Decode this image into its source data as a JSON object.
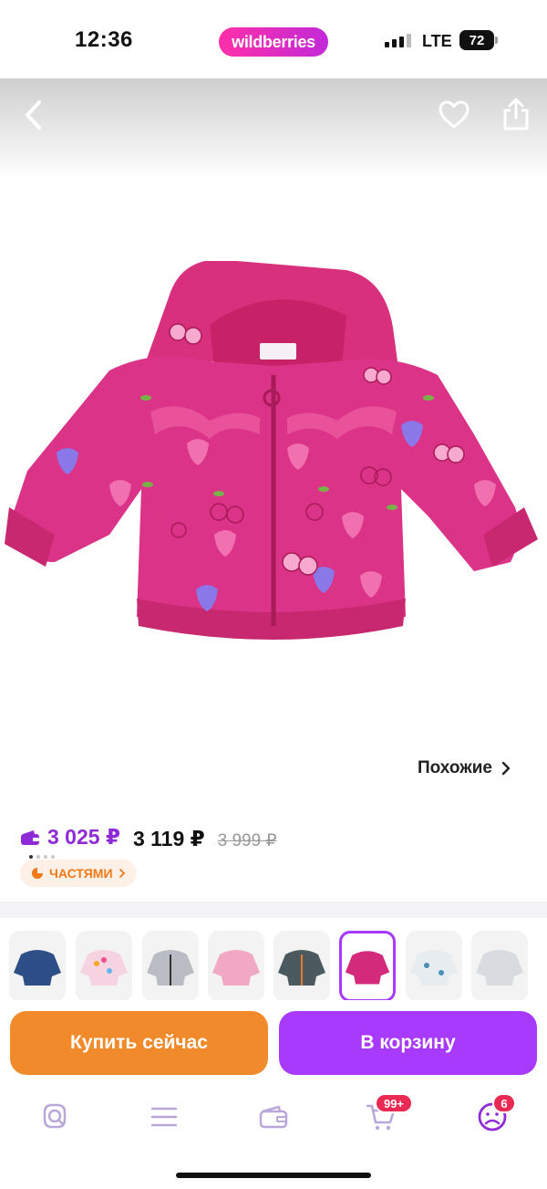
{
  "status_bar": {
    "time": "12:36",
    "brand": "wildberries",
    "network": "LTE",
    "battery": "72"
  },
  "header": {
    "back_icon": "chevron-left-icon",
    "favorite_icon": "heart-icon",
    "share_icon": "share-icon"
  },
  "gallery": {
    "product_image": "pink-strawberry-cherry-print-hooded-jacket",
    "dots_count": 4,
    "active_dot": 0,
    "similar_label": "Похожие"
  },
  "pricing": {
    "wallet_price": "3 025 ₽",
    "price": "3 119 ₽",
    "old_price": "3 999 ₽",
    "installments_label": "ЧАСТЯМИ",
    "wallet_color": "#8f2bd6"
  },
  "variants": [
    {
      "name": "navy-print-jacket",
      "color": "#2d4e86",
      "selected": false
    },
    {
      "name": "white-multicolor-dots-jacket",
      "color": "#f5d3e0",
      "selected": false
    },
    {
      "name": "grey-print-jacket",
      "color": "#b9bcc2",
      "selected": false
    },
    {
      "name": "light-pink-jacket",
      "color": "#f1a8c3",
      "selected": false
    },
    {
      "name": "dark-teal-print-jacket",
      "color": "#4a5a5e",
      "selected": false
    },
    {
      "name": "pink-strawberry-jacket",
      "color": "#d42a7c",
      "selected": true
    },
    {
      "name": "white-floral-jacket",
      "color": "#e6ecef",
      "selected": false
    },
    {
      "name": "white-grey-jacket",
      "color": "#d8dbe0",
      "selected": false
    }
  ],
  "actions": {
    "buy_now": "Купить сейчас",
    "add_to_cart": "В корзину",
    "buy_color": "#f08a2a",
    "cart_color": "#a73afd"
  },
  "bottom_nav": {
    "items": [
      "search-icon",
      "catalog-icon",
      "wallet-icon",
      "cart-icon",
      "profile-icon"
    ],
    "cart_badge": "99+",
    "profile_badge": "6"
  }
}
